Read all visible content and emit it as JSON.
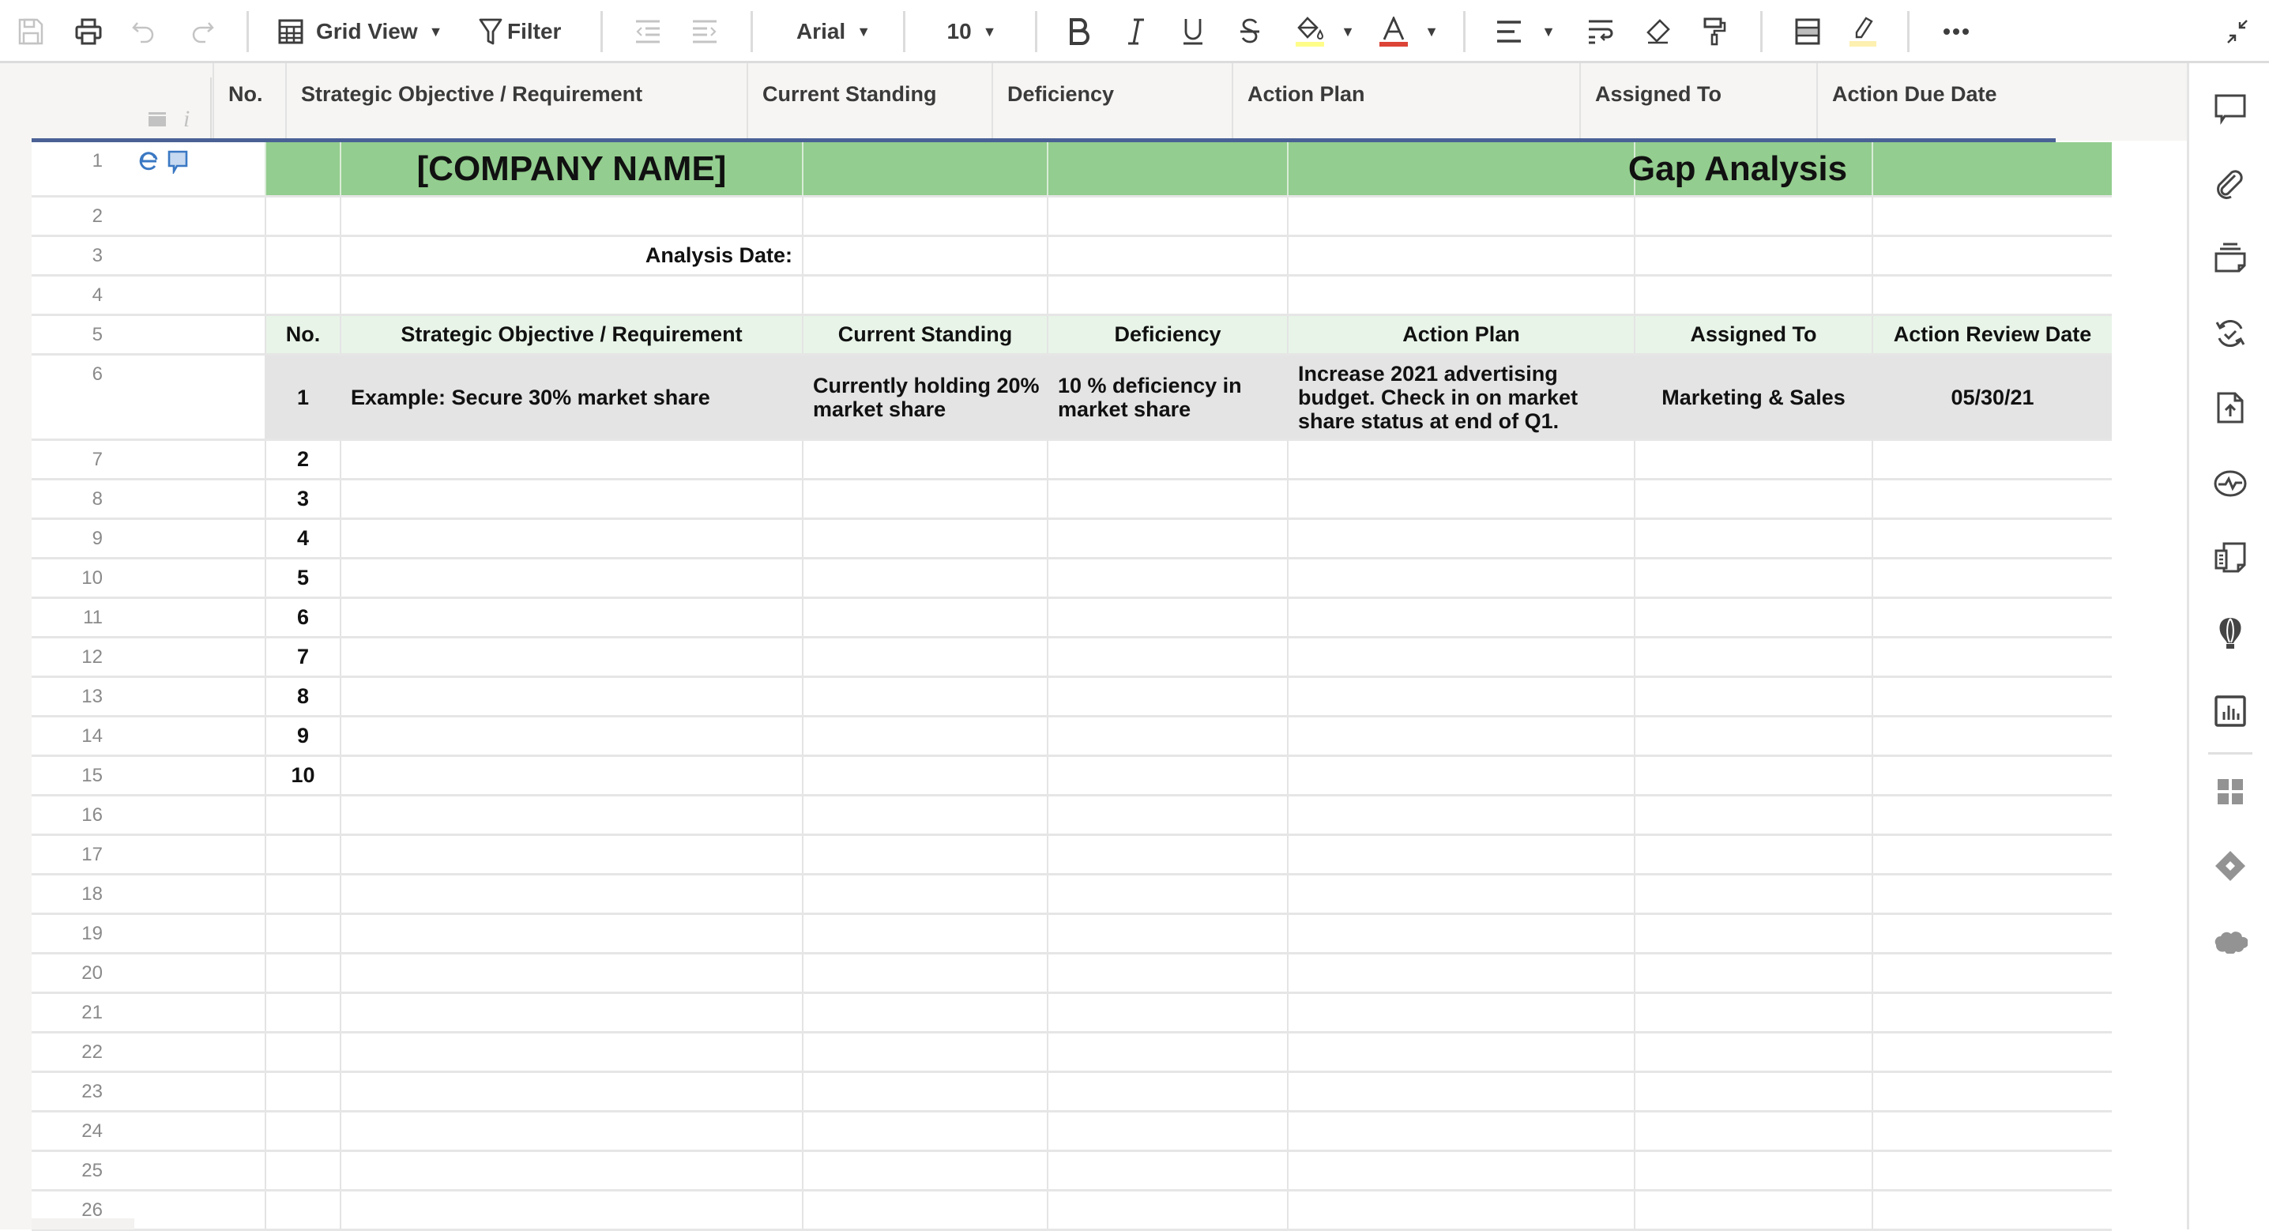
{
  "toolbar": {
    "save_icon": "save-icon",
    "print_icon": "print-icon",
    "undo_icon": "undo-icon",
    "redo_icon": "redo-icon",
    "view_label": "Grid View",
    "filter_label": "Filter",
    "font_family": "Arial",
    "font_size": "10",
    "bold": "B",
    "colors": {
      "fill_highlight": "#fffd8a",
      "text_color": "#dc4437",
      "highlight": "#fdf0b0"
    }
  },
  "columns": [
    {
      "label": "No."
    },
    {
      "label": "Strategic Objective / Requirement"
    },
    {
      "label": "Current Standing"
    },
    {
      "label": "Deficiency"
    },
    {
      "label": "Action Plan"
    },
    {
      "label": "Assigned To"
    },
    {
      "label": "Action Due Date"
    }
  ],
  "sheet": {
    "company_name": "[COMPANY NAME]",
    "title": "Gap Analysis",
    "analysis_date_label": "Analysis Date:",
    "table_headers": [
      "No.",
      "Strategic Objective / Requirement",
      "Current Standing",
      "Deficiency",
      "Action Plan",
      "Assigned To",
      "Action Review Date"
    ],
    "example_row": {
      "no": "1",
      "objective": "Example: Secure 30% market share",
      "standing": "Currently holding 20% market share",
      "deficiency": "10 % deficiency in market share",
      "action_plan": "Increase 2021 advertising budget. Check in on market share status at end of Q1.",
      "assigned_to": "Marketing & Sales",
      "review_date": "05/30/21"
    },
    "numbered_rows": [
      "2",
      "3",
      "4",
      "5",
      "6",
      "7",
      "8",
      "9",
      "10"
    ],
    "row_numbers": [
      "1",
      "2",
      "3",
      "4",
      "5",
      "6",
      "7",
      "8",
      "9",
      "10",
      "11",
      "12",
      "13",
      "14",
      "15",
      "16",
      "17",
      "18",
      "19",
      "20",
      "21",
      "22",
      "23",
      "24",
      "25",
      "26"
    ]
  },
  "colors": {
    "title_green": "#93cd8f",
    "header_green": "#e8f4e8",
    "example_gray": "#e4e4e4",
    "accent_blue": "#4a6195"
  },
  "right_sidebar": [
    "comments-icon",
    "attachments-icon",
    "proofs-icon",
    "update-requests-icon",
    "publish-icon",
    "activity-log-icon",
    "summary-icon",
    "brandfolder-icon",
    "dashboard-icon",
    "apps-icon",
    "jira-icon",
    "salesforce-icon"
  ]
}
